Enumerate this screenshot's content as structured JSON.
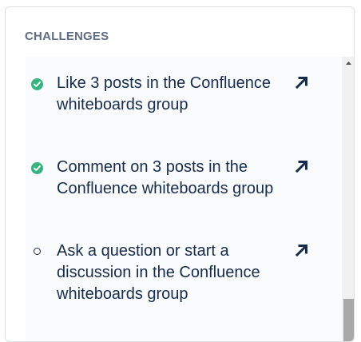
{
  "panel": {
    "title": "CHALLENGES"
  },
  "challenges": [
    {
      "text": "Like 3 posts in the Confluence whiteboards group",
      "status": "completed",
      "status_icon": "check-circle-icon",
      "link_icon": "arrow-up-right-icon"
    },
    {
      "text": "Comment on 3 posts in the Confluence whiteboards group",
      "status": "completed",
      "status_icon": "check-circle-icon",
      "link_icon": "arrow-up-right-icon"
    },
    {
      "text": "Ask a question or start a discussion in the Confluence whiteboards group",
      "status": "incomplete",
      "status_icon": "empty-circle-icon",
      "link_icon": "arrow-up-right-icon"
    }
  ],
  "colors": {
    "completed": "#36b37e",
    "text": "#172b4d",
    "title": "#5e6c84"
  }
}
